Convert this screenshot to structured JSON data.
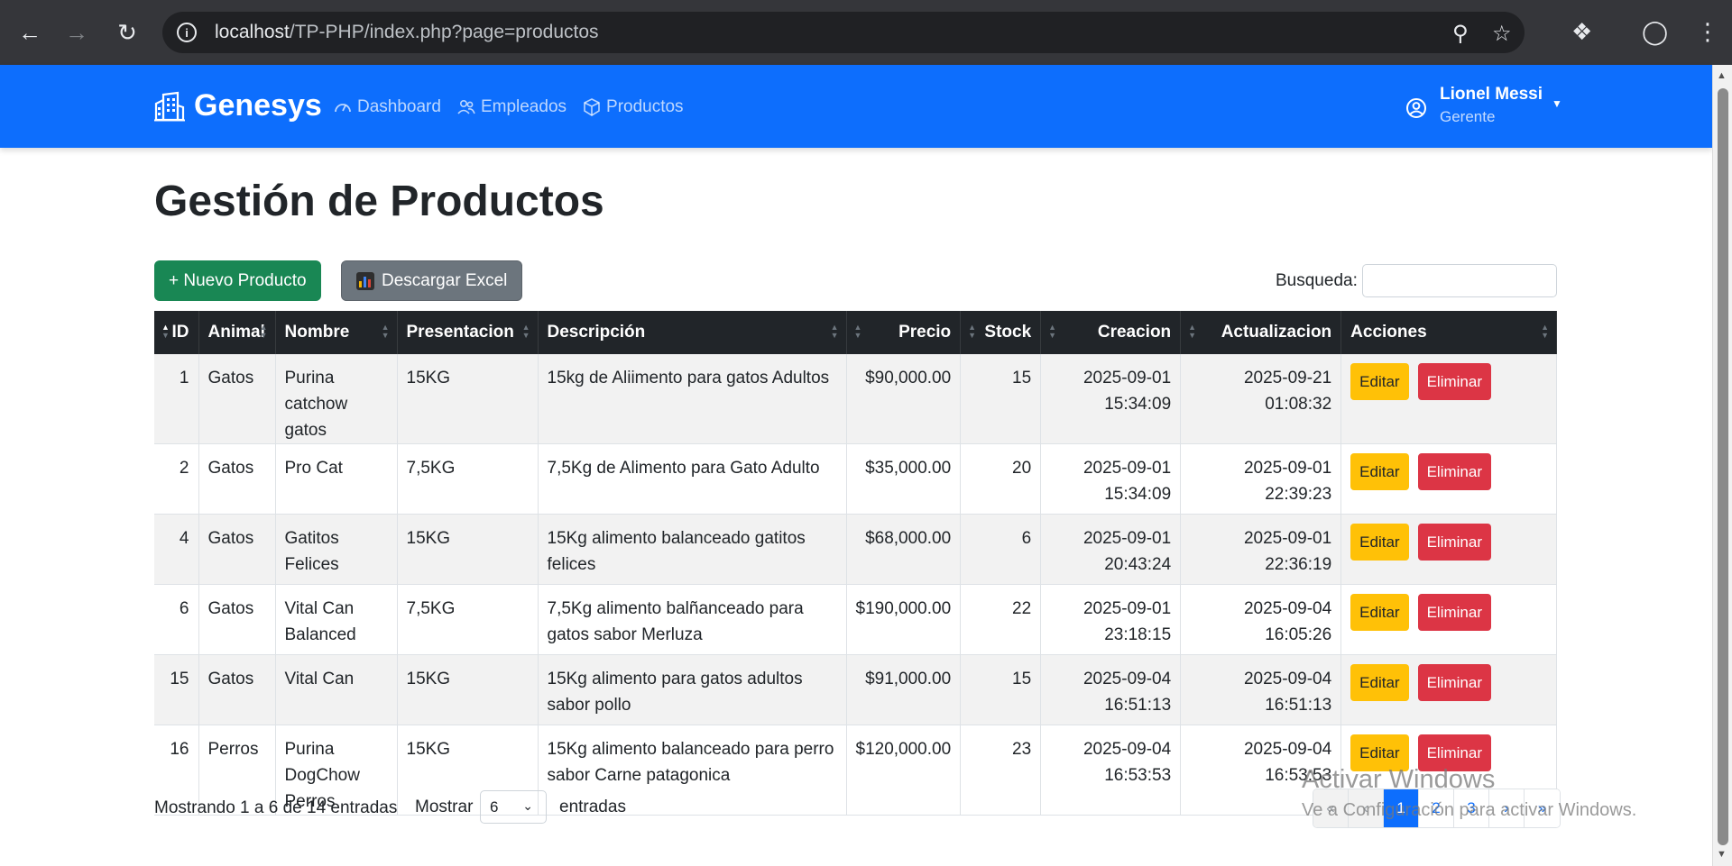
{
  "browser": {
    "url_host": "localhost",
    "url_path": "/TP-PHP/index.php?page=productos"
  },
  "navbar": {
    "brand": "Genesys",
    "links": [
      {
        "label": "Dashboard",
        "icon": "gauge-icon"
      },
      {
        "label": "Empleados",
        "icon": "people-icon"
      },
      {
        "label": "Productos",
        "icon": "box-icon"
      }
    ],
    "user": {
      "name": "Lionel Messi",
      "role": "Gerente"
    }
  },
  "page": {
    "title": "Gestión de Productos",
    "new_button": "+ Nuevo Producto",
    "excel_button": "Descargar Excel",
    "search_label": "Busqueda:",
    "search_value": ""
  },
  "table": {
    "headers": [
      "ID",
      "Animal",
      "Nombre",
      "Presentacion",
      "Descripción",
      "Precio",
      "Stock",
      "Creacion",
      "Actualizacion",
      "Acciones"
    ],
    "edit_label": "Editar",
    "delete_label": "Eliminar",
    "rows": [
      {
        "id": "1",
        "animal": "Gatos",
        "nombre": "Purina catchow gatos",
        "presentacion": "15KG",
        "descripcion": "15kg de Aliimento para gatos Adultos",
        "precio": "$90,000.00",
        "stock": "15",
        "creacion": "2025-09-01 15:34:09",
        "actualizacion": "2025-09-21 01:08:32"
      },
      {
        "id": "2",
        "animal": "Gatos",
        "nombre": "Pro Cat",
        "presentacion": "7,5KG",
        "descripcion": "7,5Kg de Alimento para Gato Adulto",
        "precio": "$35,000.00",
        "stock": "20",
        "creacion": "2025-09-01 15:34:09",
        "actualizacion": "2025-09-01 22:39:23"
      },
      {
        "id": "4",
        "animal": "Gatos",
        "nombre": "Gatitos Felices",
        "presentacion": "15KG",
        "descripcion": "15Kg alimento balanceado gatitos felices",
        "precio": "$68,000.00",
        "stock": "6",
        "creacion": "2025-09-01 20:43:24",
        "actualizacion": "2025-09-01 22:36:19"
      },
      {
        "id": "6",
        "animal": "Gatos",
        "nombre": "Vital Can Balanced",
        "presentacion": "7,5KG",
        "descripcion": "7,5Kg alimento balñanceado para gatos sabor Merluza",
        "precio": "$190,000.00",
        "stock": "22",
        "creacion": "2025-09-01 23:18:15",
        "actualizacion": "2025-09-04 16:05:26"
      },
      {
        "id": "15",
        "animal": "Gatos",
        "nombre": "Vital Can",
        "presentacion": "15KG",
        "descripcion": "15Kg alimento para gatos adultos sabor pollo",
        "precio": "$91,000.00",
        "stock": "15",
        "creacion": "2025-09-04 16:51:13",
        "actualizacion": "2025-09-04 16:51:13"
      },
      {
        "id": "16",
        "animal": "Perros",
        "nombre": "Purina DogChow Perros",
        "presentacion": "15KG",
        "descripcion": "15Kg alimento balanceado para perro sabor Carne patagonica",
        "precio": "$120,000.00",
        "stock": "23",
        "creacion": "2025-09-04 16:53:53",
        "actualizacion": "2025-09-04 16:53:53"
      }
    ]
  },
  "footer": {
    "info": "Mostrando 1 a 6 de 14 entradas",
    "show_label": "Mostrar",
    "page_size": "6",
    "entries_label": "entradas",
    "pages": [
      "«",
      "‹",
      "1",
      "2",
      "3",
      "›",
      "»"
    ],
    "current_page": "1"
  },
  "watermark": {
    "line1": "Activar Windows",
    "line2": "Ve a Configuración para activar Windows."
  },
  "colors": {
    "navbar": "#0d6efd",
    "header_dark": "#212529",
    "success": "#198754",
    "secondary": "#6c757d",
    "warning": "#ffc107",
    "danger": "#dc3545"
  }
}
